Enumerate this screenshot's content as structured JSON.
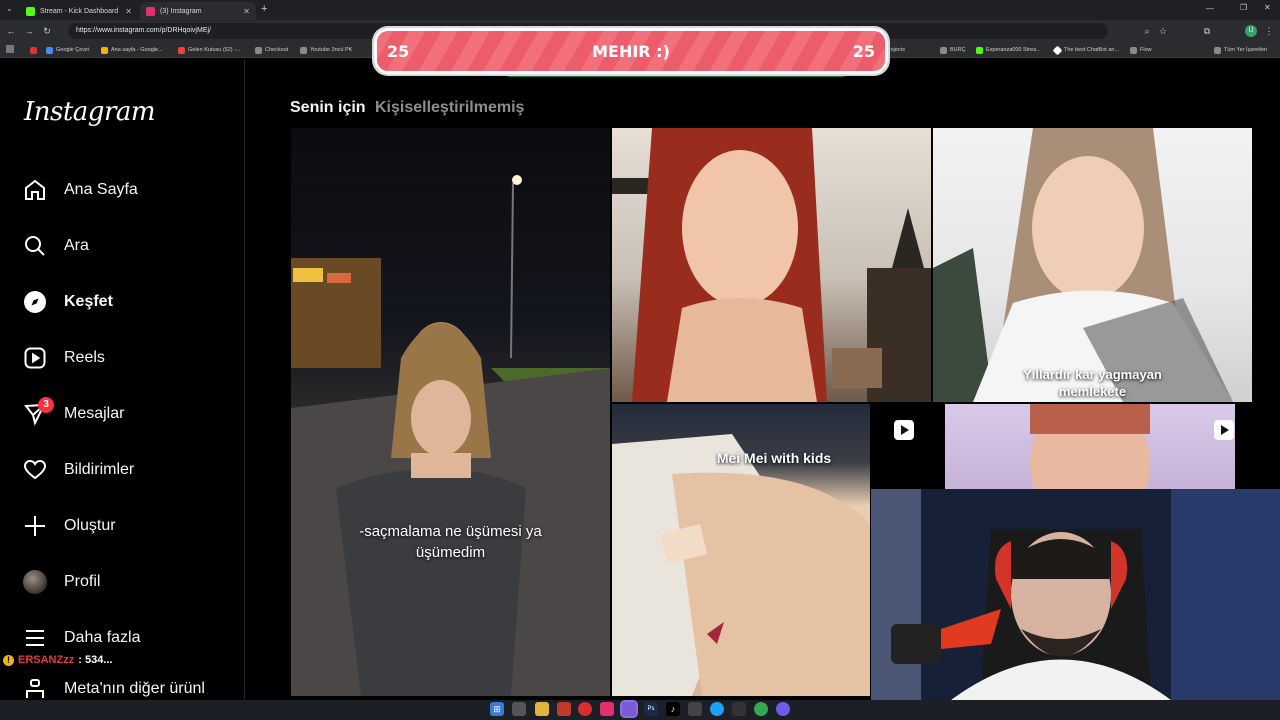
{
  "browser": {
    "tabs": [
      {
        "label": "Stream - Kick Dashboard",
        "color": "#53fc18"
      },
      {
        "label": "(3) Instagram",
        "color": "#e1306c"
      }
    ],
    "url": "https://www.instagram.com/p/DRHqoivjMEj/",
    "bookmarks": [
      "Google Çeviri",
      "Ana sayfa - Google...",
      "Gelen Kutusu (52) -...",
      "Checkout",
      "Youtube 3ncü PK",
      "ayGen - Projects",
      "BURÇ",
      "Esperanza000 Strea...",
      "The best ChatBot an...",
      "Flow",
      "Tüm Yer İşaretleri"
    ]
  },
  "overlay": {
    "left_count": "25",
    "label": "MEHIR :)",
    "right_count": "25"
  },
  "instagram": {
    "logo": "Instagram",
    "nav": [
      {
        "label": "Ana Sayfa",
        "icon": "home-icon"
      },
      {
        "label": "Ara",
        "icon": "search-icon"
      },
      {
        "label": "Keşfet",
        "icon": "compass-icon"
      },
      {
        "label": "Reels",
        "icon": "reels-icon"
      },
      {
        "label": "Mesajlar",
        "icon": "messenger-icon",
        "badge": "3"
      },
      {
        "label": "Bildirimler",
        "icon": "heart-icon"
      },
      {
        "label": "Oluştur",
        "icon": "plus-icon"
      },
      {
        "label": "Profil",
        "icon": "avatar"
      },
      {
        "label": "Daha fazla",
        "icon": "menu-icon"
      },
      {
        "label": "Meta'nın diğer ürünl",
        "icon": "meta-icon"
      }
    ],
    "feed_tabs": {
      "active": "Senin için",
      "inactive": "Kişiselleştirilmemiş"
    },
    "tiles": [
      {
        "caption": "-saçmalama ne üşümesi ya\nüşümedim"
      },
      {
        "caption": ""
      },
      {
        "caption": "Yıllardır kar yagmayan\nmemlekete"
      },
      {
        "caption": "Mei Mei with kids",
        "reel": true
      },
      {
        "caption": "",
        "reel": true
      }
    ]
  },
  "chat": {
    "user": "ERSANZzz",
    "text": ": 534..."
  }
}
